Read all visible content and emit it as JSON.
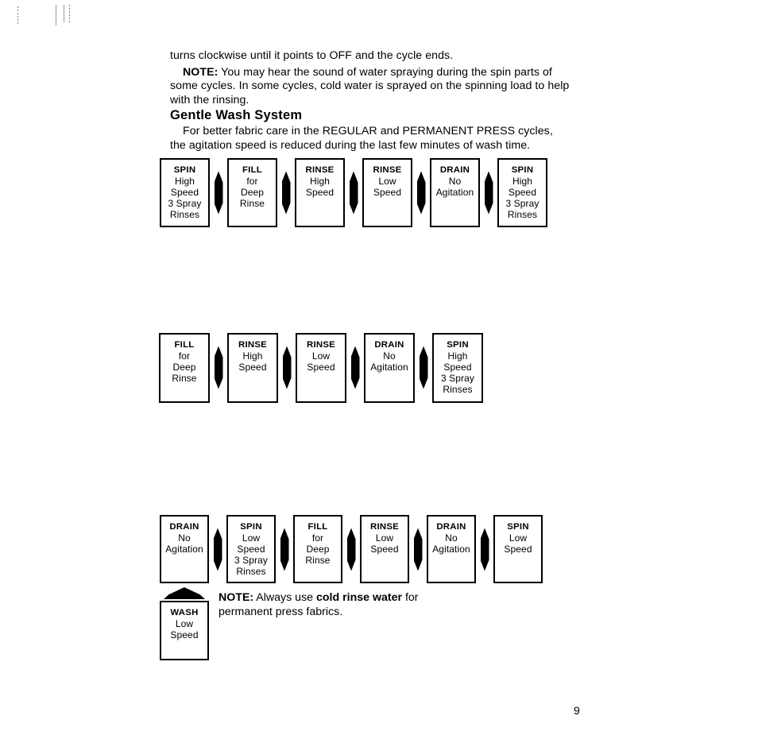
{
  "page": {
    "number": "9"
  },
  "prose": {
    "line1": "turns clockwise until it points to OFF and the cycle ends.",
    "note_label": "NOTE:",
    "note_text": " You may hear the sound of water spraying during the spin parts of some cycles. In some cycles, cold water is sprayed on the spinning load to help with the rinsing."
  },
  "section": {
    "heading": "Gentle Wash System",
    "body": "For better fabric care in the REGULAR and PERMANENT PRESS cycles, the agitation speed is reduced during the last few minutes of wash time."
  },
  "bottom_note": {
    "label": "NOTE:",
    "text_before": " Always use ",
    "emphasis": "cold rinse water",
    "text_after": " for permanent press fabrics."
  },
  "flow_rows": [
    {
      "id": "flow-row-1",
      "boxes": [
        {
          "title": "SPIN",
          "lines": [
            "High",
            "Speed",
            "3 Spray",
            "Rinses"
          ]
        },
        {
          "title": "FILL",
          "lines": [
            "for",
            "Deep",
            "Rinse"
          ]
        },
        {
          "title": "RINSE",
          "lines": [
            "High",
            "Speed"
          ]
        },
        {
          "title": "RINSE",
          "lines": [
            "Low",
            "Speed"
          ]
        },
        {
          "title": "DRAIN",
          "lines": [
            "No",
            "Agitation"
          ]
        },
        {
          "title": "SPIN",
          "lines": [
            "High",
            "Speed",
            "3 Spray",
            "Rinses"
          ]
        }
      ]
    },
    {
      "id": "flow-row-2",
      "boxes": [
        {
          "title": "FILL",
          "lines": [
            "for",
            "Deep",
            "Rinse"
          ]
        },
        {
          "title": "RINSE",
          "lines": [
            "High",
            "Speed"
          ]
        },
        {
          "title": "RINSE",
          "lines": [
            "Low",
            "Speed"
          ]
        },
        {
          "title": "DRAIN",
          "lines": [
            "No",
            "Agitation"
          ]
        },
        {
          "title": "SPIN",
          "lines": [
            "High",
            "Speed",
            "3 Spray",
            "Rinses"
          ]
        }
      ]
    },
    {
      "id": "flow-row-3",
      "boxes": [
        {
          "title": "DRAIN",
          "lines": [
            "No",
            "Agitation"
          ]
        },
        {
          "title": "SPIN",
          "lines": [
            "Low",
            "Speed",
            "3 Spray",
            "Rinses"
          ]
        },
        {
          "title": "FILL",
          "lines": [
            "for",
            "Deep",
            "Rinse"
          ]
        },
        {
          "title": "RINSE",
          "lines": [
            "Low",
            "Speed"
          ]
        },
        {
          "title": "DRAIN",
          "lines": [
            "No",
            "Agitation"
          ]
        },
        {
          "title": "SPIN",
          "lines": [
            "Low",
            "Speed"
          ]
        }
      ]
    }
  ],
  "wash_box": {
    "title": "WASH",
    "lines": [
      "Low",
      "Speed"
    ]
  },
  "icons": {
    "flow_arrow": "arrow-right-diamond-icon",
    "up_arrow": "arrow-up-icon"
  },
  "colors": {
    "ink": "#000000",
    "paper": "#ffffff",
    "scan_artifact": "#8c8c8c"
  }
}
